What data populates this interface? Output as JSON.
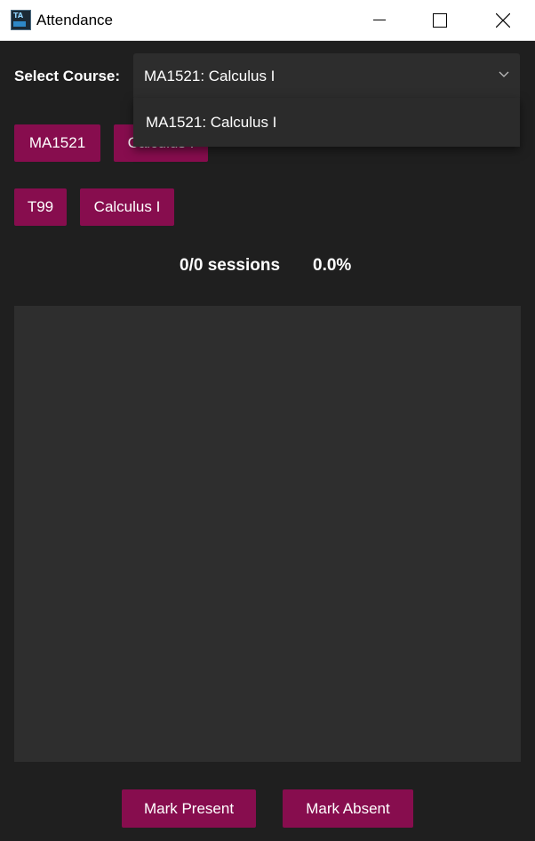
{
  "window": {
    "title": "Attendance",
    "icon": "ta-app-icon",
    "icon_text_top": "TA",
    "controls": [
      "minimize-icon",
      "maximize-icon",
      "close-icon"
    ]
  },
  "course_select": {
    "label": "Select Course:",
    "selected": "MA1521: Calculus I",
    "options": [
      "MA1521: Calculus I"
    ],
    "expanded": true
  },
  "chips": {
    "row1": [
      "MA1521",
      "Calculus I"
    ],
    "row2": [
      "T99",
      "Calculus I"
    ]
  },
  "stats": {
    "sessions": "0/0 sessions",
    "percent": "0.0%"
  },
  "actions": {
    "present": "Mark Present",
    "absent": "Mark Absent"
  },
  "colors": {
    "background": "#1f1f1f",
    "accent": "#870d4e",
    "panel": "#2e2e2e",
    "combo": "#2d2d2d"
  }
}
